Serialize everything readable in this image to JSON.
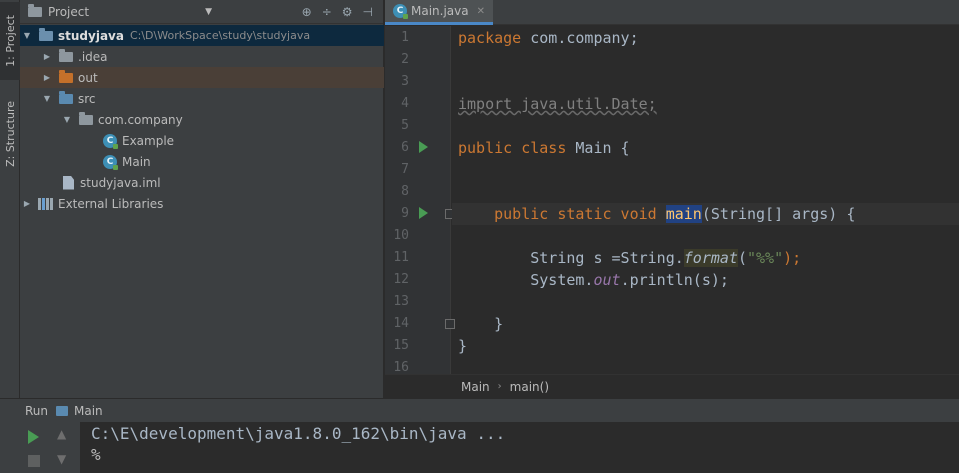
{
  "sidebar": {
    "tabs": [
      {
        "label": "1: Project"
      },
      {
        "label": "Z: Structure"
      }
    ]
  },
  "project_panel": {
    "title": "Project",
    "tree": [
      {
        "label": "studyjava",
        "path": "C:\\D\\WorkSpace\\study\\studyjava",
        "arrow": "▼",
        "icon": "module-folder-icon"
      },
      {
        "label": ".idea",
        "arrow": "▶",
        "icon": "folder-icon"
      },
      {
        "label": "out",
        "arrow": "▶",
        "icon": "output-folder-icon"
      },
      {
        "label": "src",
        "arrow": "▼",
        "icon": "source-folder-icon"
      },
      {
        "label": "com.company",
        "arrow": "▼",
        "icon": "package-icon"
      },
      {
        "label": "Example",
        "arrow": "",
        "icon": "java-class-icon"
      },
      {
        "label": "Main",
        "arrow": "",
        "icon": "java-class-icon"
      },
      {
        "label": "studyjava.iml",
        "arrow": "",
        "icon": "iml-file-icon"
      },
      {
        "label": "External Libraries",
        "arrow": "▶",
        "icon": "library-icon"
      }
    ]
  },
  "editor": {
    "tab_label": "Main.java",
    "line_numbers": [
      "1",
      "2",
      "3",
      "4",
      "5",
      "6",
      "7",
      "8",
      "9",
      "10",
      "11",
      "12",
      "13",
      "14",
      "15",
      "16"
    ],
    "code": {
      "l1_kw": "package",
      "l1_rest": " com.company;",
      "l4_import": "import java.util.Date;",
      "l6_kw": "public class",
      "l6_rest": " Main {",
      "l9_indent": "    ",
      "l9_kw": "public static void",
      "l9_space": " ",
      "l9_name": "main",
      "l9_rest": "(String[] args) {",
      "l11_pre": "        String s =String.",
      "l11_method": "format",
      "l11_open": "(",
      "l11_str": "\"%%\"",
      "l11_close": ");",
      "l12_pre": "        System.",
      "l12_field": "out",
      "l12_rest": ".println(s);",
      "l14": "    }",
      "l15": "}"
    },
    "breadcrumb": [
      "Main",
      "main()"
    ]
  },
  "run": {
    "title": "Run",
    "config_name": "Main",
    "console": [
      "C:\\E\\development\\java1.8.0_162\\bin\\java ...",
      "%"
    ]
  },
  "colors": {
    "keyword": "#cc7832",
    "string": "#6a8759",
    "static_field": "#9876aa",
    "method_decl": "#ffc66d",
    "selection": "#0d293e",
    "run_green": "#499c54"
  }
}
